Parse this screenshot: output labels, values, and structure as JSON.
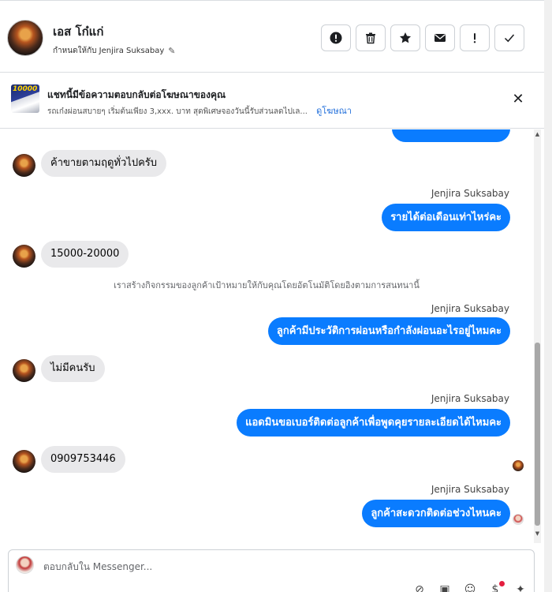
{
  "header": {
    "name": "เอส โก๋แก่",
    "assigned_text": "กำหนดให้กับ Jenjira Suksabay",
    "action_buttons": [
      {
        "id": "spam",
        "icon": "exclamation-circle-icon"
      },
      {
        "id": "delete",
        "icon": "trash-icon"
      },
      {
        "id": "star",
        "icon": "star-icon"
      },
      {
        "id": "mark-unread",
        "icon": "envelope-icon"
      },
      {
        "id": "follow-up",
        "icon": "exclamation-icon"
      },
      {
        "id": "done",
        "icon": "check-icon"
      }
    ]
  },
  "banner": {
    "title": "แชทนี้มีข้อความตอบกลับต่อโฆษณาของคุณ",
    "subtitle": "รถเก๋งผ่อนสบายๆ เริ่มต้นเพียง 3,xxx. บาท สุดพิเศษจองวันนี้รับส่วนลดไปเล...",
    "link": "ดูโฆษณา",
    "thumb_text": "10000"
  },
  "messages": [
    {
      "type": "in",
      "text": "ค้าขายตามฤดูทั่วไปครับ"
    },
    {
      "type": "sender",
      "text": "Jenjira Suksabay"
    },
    {
      "type": "out",
      "text": "รายได้ต่อเดือนเท่าไหร่คะ"
    },
    {
      "type": "in",
      "text": "15000-20000"
    },
    {
      "type": "system",
      "text": "เราสร้างกิจกรรมของลูกค้าเป้าหมายให้กับคุณโดยอัตโนมัติโดยอิงตามการสนทนานี้"
    },
    {
      "type": "sender",
      "text": "Jenjira Suksabay"
    },
    {
      "type": "out",
      "text": "ลูกค้ามีประวัติการผ่อนหรือกำลังผ่อนอะไรอยู่ไหมคะ"
    },
    {
      "type": "in",
      "text": "ไม่มีคนรับ"
    },
    {
      "type": "sender",
      "text": "Jenjira Suksabay"
    },
    {
      "type": "out",
      "text": "แอดมินขอเบอร์ติดต่อลูกค้าเพื่อพูดคุยรายละเอียดได้ไหมคะ"
    },
    {
      "type": "in",
      "text": "0909753446"
    },
    {
      "type": "sender",
      "text": "Jenjira Suksabay"
    },
    {
      "type": "out",
      "text": "ลูกค้าสะดวกติดต่อช่วงไหนคะ"
    }
  ],
  "composer": {
    "placeholder": "ตอบกลับใน Messenger...",
    "tools": [
      "attachment-icon",
      "gif-icon",
      "emoji-icon",
      "dollar-icon",
      "sparkle-icon"
    ]
  },
  "colors": {
    "outgoing_bubble": "#0a7cff",
    "incoming_bubble": "#e9e9eb",
    "link": "#216fdb"
  }
}
